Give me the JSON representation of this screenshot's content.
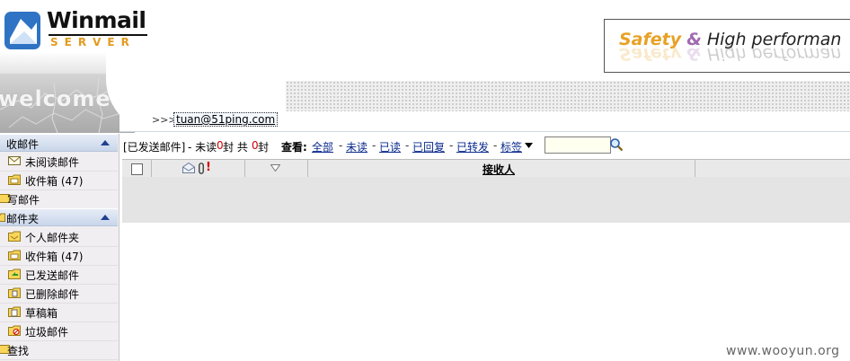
{
  "header": {
    "logo_title": "Winmail",
    "logo_subtitle": "SERVER",
    "welcome": "welcome",
    "slogan_safety": "Safety",
    "slogan_amp": "&",
    "slogan_rest": "High performan",
    "user_prefix": ">>>",
    "user_email": "tuan@51ping.com"
  },
  "sidebar": {
    "inbox_section": "收邮件",
    "unread_item": "未阅读邮件",
    "inbox_item": "收件箱 (47)",
    "compose": "写邮件",
    "folders_section": "邮件夹",
    "folders": [
      {
        "label": "个人邮件夹",
        "icon": "folder-personal-icon"
      },
      {
        "label": "收件箱 (47)",
        "icon": "folder-inbox-icon"
      },
      {
        "label": "已发送邮件",
        "icon": "folder-sent-icon"
      },
      {
        "label": "已删除邮件",
        "icon": "folder-trash-icon"
      },
      {
        "label": "草稿箱",
        "icon": "folder-drafts-icon"
      },
      {
        "label": "垃圾邮件",
        "icon": "folder-junk-icon"
      }
    ],
    "search": "查找"
  },
  "toolbar": {
    "folder_name": "[已发送邮件]",
    "unread_prefix": "- 未读",
    "unread_count": "0",
    "unread_suffix": "封 共",
    "total_count": "0",
    "total_suffix": "封",
    "view_label": "查看:",
    "filters": [
      "全部",
      "未读",
      "已读",
      "已回复",
      "已转发",
      "标签"
    ],
    "search_value": ""
  },
  "grid": {
    "col_recipient": "接收人"
  },
  "watermark": "www.wooyun.org",
  "colors": {
    "accent_blue": "#213f91",
    "link_blue": "#0a2a8c",
    "count_red": "#d20000",
    "logo_orange": "#e39b1f"
  }
}
